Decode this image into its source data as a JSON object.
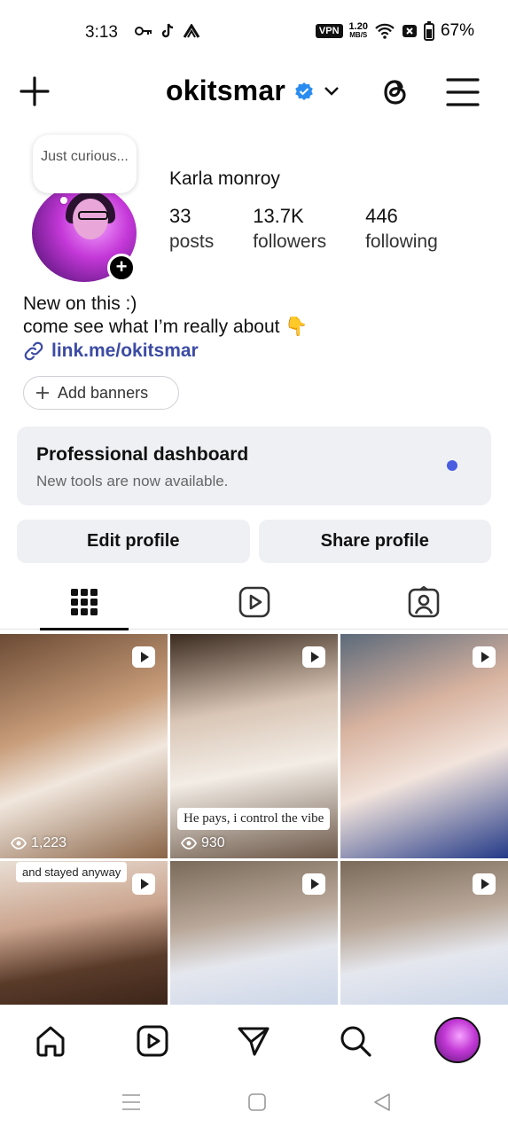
{
  "status_bar": {
    "time": "3:13",
    "vpn": "VPN",
    "speed_value": "1.20",
    "speed_unit": "MB/S",
    "battery": "67%"
  },
  "header": {
    "username": "okitsmar",
    "verified": true,
    "icons": [
      "plus-icon",
      "verified-badge-icon",
      "chevron-down-icon",
      "threads-icon",
      "menu-icon"
    ]
  },
  "profile": {
    "note": "Just curious...",
    "full_name": "Karla monroy",
    "stats": [
      {
        "value": "33",
        "label": "posts"
      },
      {
        "value": "13.7K",
        "label": "followers"
      },
      {
        "value": "446",
        "label": "following"
      }
    ],
    "bio_line1": "New on this :)",
    "bio_line2": "come see what I’m really about 👇",
    "link": "link.me/okitsmar",
    "add_banners": "Add banners"
  },
  "professional": {
    "title": "Professional dashboard",
    "subtitle": "New tools are now available.",
    "accent": "#4a5de0"
  },
  "actions": {
    "edit": "Edit profile",
    "share": "Share profile"
  },
  "tabs": [
    "grid-icon",
    "reels-icon",
    "tagged-icon"
  ],
  "grid": [
    {
      "views": "1,223",
      "caption": ""
    },
    {
      "views": "930",
      "caption": "He pays, i control the vibe"
    },
    {
      "views": "",
      "caption": ""
    },
    {
      "views": "",
      "caption": "and stayed anyway"
    },
    {
      "views": "",
      "caption": ""
    },
    {
      "views": "",
      "caption": ""
    }
  ],
  "bottom_nav": [
    "home-icon",
    "reels-icon",
    "send-icon",
    "search-icon",
    "profile-avatar"
  ]
}
